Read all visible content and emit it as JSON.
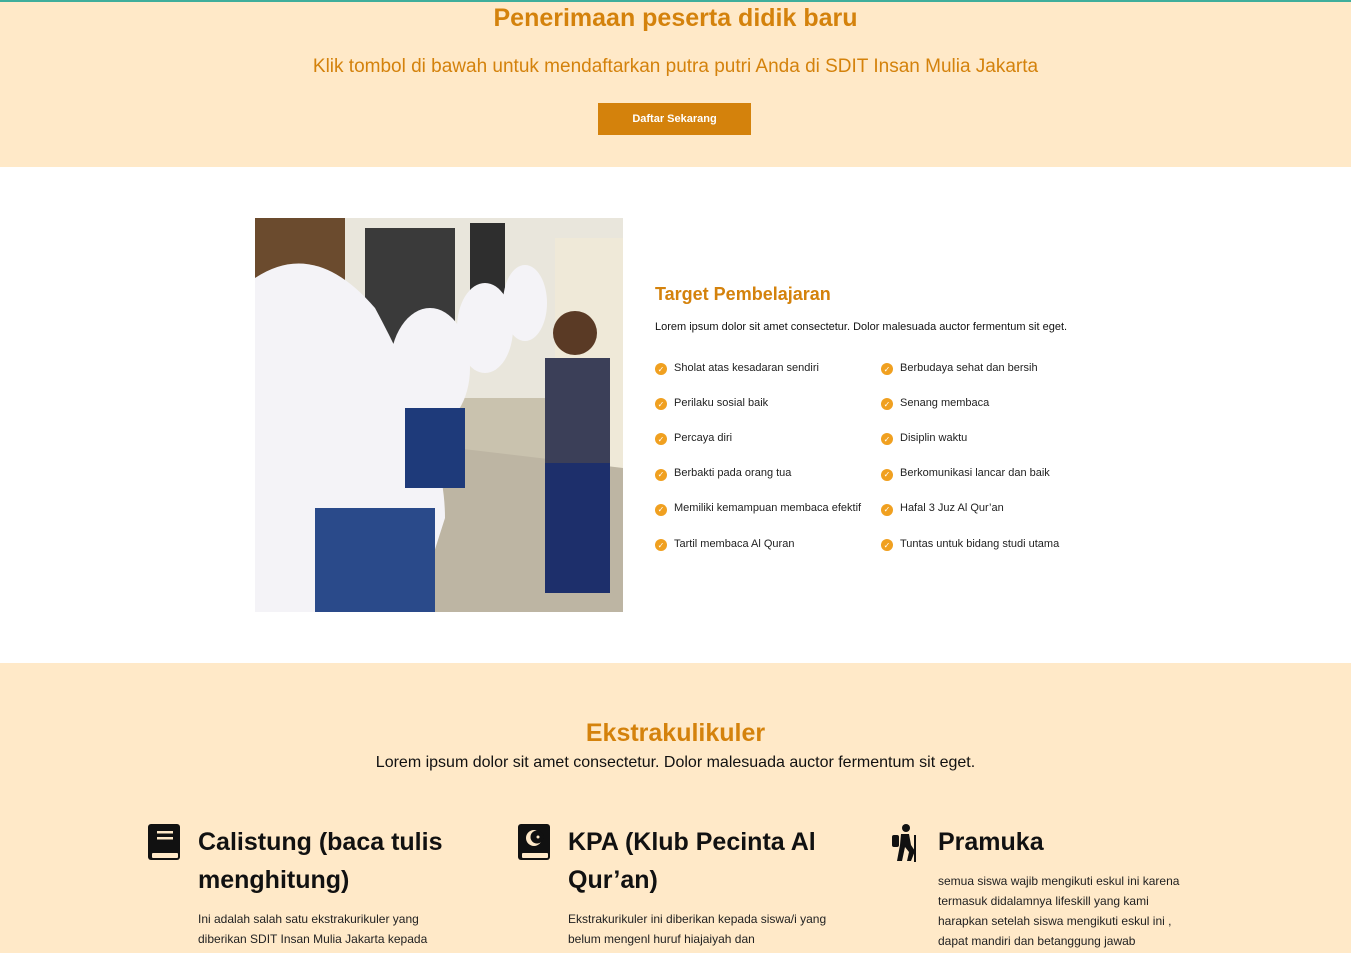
{
  "hero": {
    "title": "Penerimaan peserta didik baru",
    "subtitle": "Klik tombol di bawah untuk mendaftarkan putra putri Anda di SDIT Insan Mulia Jakarta",
    "button_label": "Daftar Sekarang"
  },
  "target": {
    "title": "Target Pembelajaran",
    "description": "Lorem ipsum dolor sit amet consectetur. Dolor malesuada auctor fermentum sit eget.",
    "left_items": [
      "Sholat atas kesadaran sendiri",
      "Perilaku sosial baik",
      "Percaya diri",
      "Berbakti pada orang tua",
      "Memiliki kemampuan membaca efektif",
      "Tartil membaca Al Quran"
    ],
    "right_items": [
      "Berbudaya sehat dan bersih",
      "Senang membaca",
      "Disiplin waktu",
      "Berkomunikasi lancar dan baik",
      "Hafal 3 Juz Al Qur’an",
      "Tuntas untuk bidang studi utama"
    ]
  },
  "ekstra": {
    "title": "Ekstrakulikuler",
    "subtitle": "Lorem ipsum dolor sit amet consectetur. Dolor malesuada auctor fermentum sit eget.",
    "cards": [
      {
        "icon": "book-icon",
        "title": "Calistung (baca tulis menghitung)",
        "body": "Ini adalah salah satu ekstrakurikuler yang diberikan SDIT Insan Mulia Jakarta kepada"
      },
      {
        "icon": "quran-icon",
        "title": "KPA (Klub Pecinta Al Qur’an)",
        "body": "Ekstrakurikuler ini diberikan kepada siswa/i yang belum mengenl huruf hiajaiyah dan"
      },
      {
        "icon": "hiking-icon",
        "title": "Pramuka",
        "body": "semua siswa wajib mengikuti eskul ini karena termasuk didalamnya lifeskill yang kami harapkan setelah siswa mengikuti eskul ini , dapat mandiri dan betanggung jawab"
      }
    ]
  },
  "colors": {
    "accent": "#d4820c",
    "cream": "#ffe9c8",
    "check": "#f0a020"
  }
}
